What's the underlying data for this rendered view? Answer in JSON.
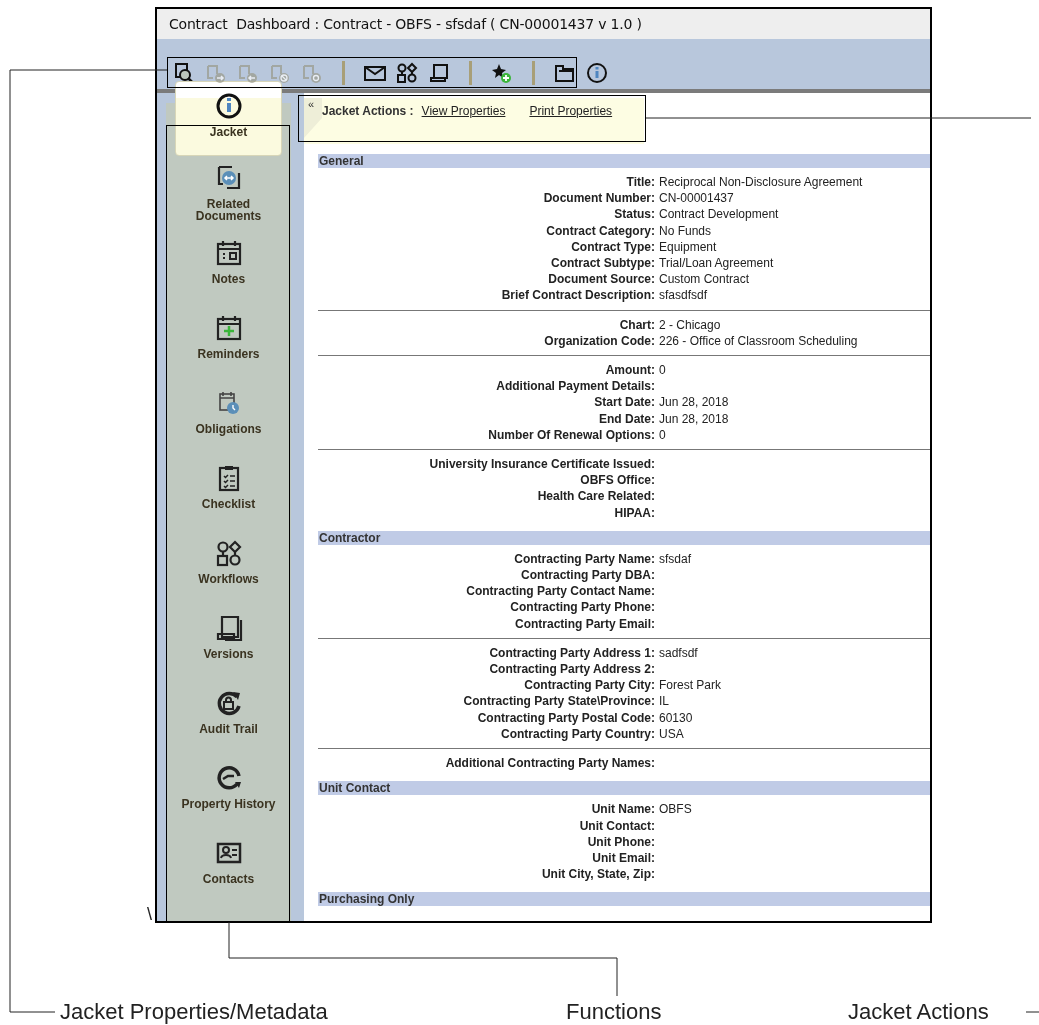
{
  "window": {
    "title": "Contract  Dashboard : Contract - OBFS - sfsdaf ( CN-00001437 v 1.0 )"
  },
  "toolbar": [
    {
      "kind": "button",
      "disabled": false
    },
    {
      "kind": "button",
      "disabled": true
    },
    {
      "kind": "button",
      "disabled": true
    },
    {
      "kind": "button",
      "disabled": true
    },
    {
      "kind": "button",
      "disabled": true
    },
    {
      "kind": "separator"
    },
    {
      "kind": "button",
      "disabled": false
    },
    {
      "kind": "button",
      "disabled": false
    },
    {
      "kind": "button",
      "disabled": false
    },
    {
      "kind": "separator"
    },
    {
      "kind": "button",
      "disabled": false
    },
    {
      "kind": "separator"
    },
    {
      "kind": "button",
      "disabled": false
    },
    {
      "kind": "button",
      "disabled": false
    }
  ],
  "sidebar": {
    "items": [
      {
        "label": "Jacket",
        "selected": true
      },
      {
        "label": "Related Documents",
        "selected": false
      },
      {
        "label": "Notes",
        "selected": false
      },
      {
        "label": "Reminders",
        "selected": false
      },
      {
        "label": "Obligations",
        "selected": false
      },
      {
        "label": "Checklist",
        "selected": false
      },
      {
        "label": "Workflows",
        "selected": false
      },
      {
        "label": "Versions",
        "selected": false
      },
      {
        "label": "Audit Trail",
        "selected": false
      },
      {
        "label": "Property History",
        "selected": false
      },
      {
        "label": "Contacts",
        "selected": false
      }
    ]
  },
  "actions_bar": {
    "collapse": "«",
    "title": "Jacket Actions :",
    "links": [
      "View Properties",
      "Print Properties"
    ]
  },
  "sections": [
    {
      "title": "General",
      "groups": [
        [
          {
            "label": "Title:",
            "value": "Reciprocal Non-Disclosure Agreement"
          },
          {
            "label": "Document Number:",
            "value": "CN-00001437"
          },
          {
            "label": "Status:",
            "value": "Contract Development"
          },
          {
            "label": "Contract Category:",
            "value": "No Funds"
          },
          {
            "label": "Contract Type:",
            "value": "Equipment"
          },
          {
            "label": "Contract Subtype:",
            "value": "Trial/Loan Agreement"
          },
          {
            "label": "Document Source:",
            "value": "Custom Contract"
          },
          {
            "label": "Brief Contract Description:",
            "value": "sfasdfsdf"
          }
        ],
        [
          {
            "label": "Chart:",
            "value": "2 - Chicago"
          },
          {
            "label": "Organization Code:",
            "value": "226 - Office of Classroom Scheduling"
          }
        ],
        [
          {
            "label": "Amount:",
            "value": "0"
          },
          {
            "label": "Additional Payment Details:"
          },
          {
            "label": "Start Date:",
            "value": "Jun 28, 2018"
          },
          {
            "label": "End Date:",
            "value": "Jun 28, 2018"
          },
          {
            "label": "Number Of Renewal Options:",
            "value": "0"
          }
        ],
        [
          {
            "label": "University Insurance Certificate Issued:"
          },
          {
            "label": "OBFS Office:"
          },
          {
            "label": "Health Care Related:"
          },
          {
            "label": "HIPAA:"
          }
        ]
      ]
    },
    {
      "title": "Contractor",
      "groups": [
        [
          {
            "label": "Contracting Party Name:",
            "value": "sfsdaf"
          },
          {
            "label": "Contracting Party DBA:"
          },
          {
            "label": "Contracting Party Contact Name:"
          },
          {
            "label": "Contracting Party Phone:"
          },
          {
            "label": "Contracting Party Email:"
          }
        ],
        [
          {
            "label": "Contracting Party Address 1:",
            "value": "sadfsdf"
          },
          {
            "label": "Contracting Party Address 2:"
          },
          {
            "label": "Contracting Party City:",
            "value": "Forest Park"
          },
          {
            "label": "Contracting Party State\\Province:",
            "value": "IL"
          },
          {
            "label": "Contracting Party Postal Code:",
            "value": "60130"
          },
          {
            "label": "Contracting Party Country:",
            "value": "USA"
          }
        ],
        [
          {
            "label": "Additional Contracting Party Names:"
          }
        ]
      ]
    },
    {
      "title": "Unit Contact",
      "groups": [
        [
          {
            "label": "Unit Name:",
            "value": "OBFS"
          },
          {
            "label": "Unit Contact:"
          },
          {
            "label": "Unit Phone:"
          },
          {
            "label": "Unit Email:"
          },
          {
            "label": "Unit City, State, Zip:"
          }
        ]
      ]
    },
    {
      "title": "Purchasing Only"
    }
  ],
  "annotations": {
    "mark": "\\",
    "labels": [
      "Jacket Properties/Metadata",
      "Functions",
      "Jacket Actions"
    ]
  }
}
